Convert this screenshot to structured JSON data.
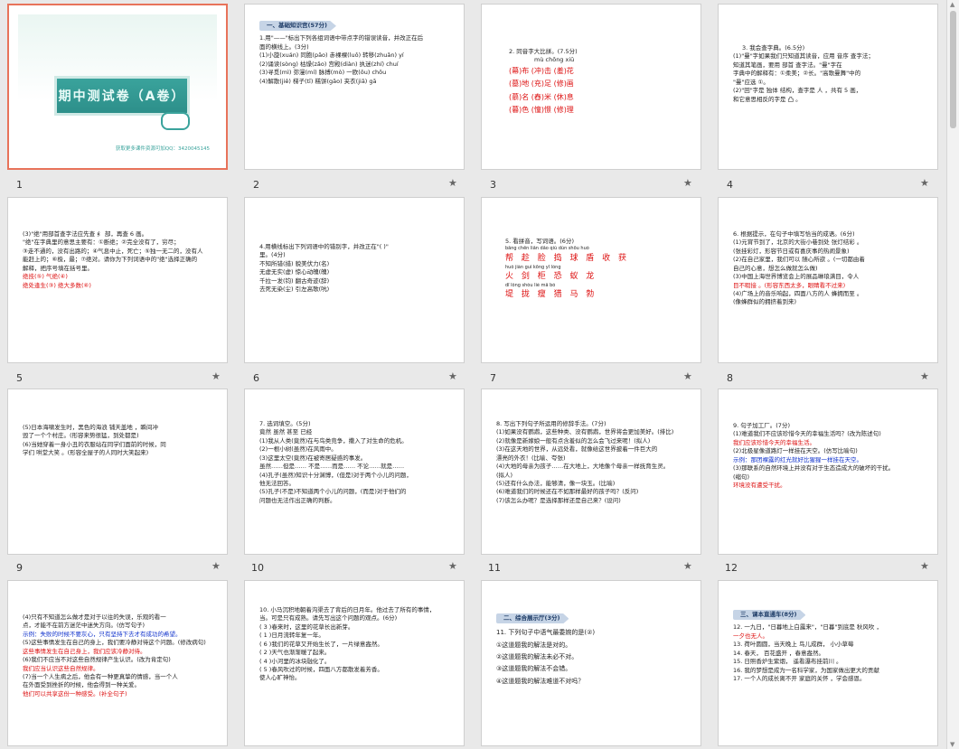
{
  "slides": [
    {
      "num": "1",
      "cover_title": "期中测试卷（A卷）",
      "footer": "获取更多课件资源可加QQ：3420045145"
    },
    {
      "num": "2",
      "section": "一、基础知识宫(57分)",
      "lines": [
        "1.用\"——\"标出下列各组词语中带点字的错误读音，并改正在后",
        "面的横线上。(3分)",
        "(1)小旋(xuán) 同胞(pāo) 赤裸裸(luǒ) 转移(zhuǎn) yí",
        "(2)诵读(sòng) 枯燥(zǎo) 宫殿(diàn) 执迷(zhí) chuí",
        "(3)寻觅(mì) 弥漫(mí) 脉搏(mò) 一欧(ōu) chōu",
        "(4)解散(jiě) 梯子(tī) 糕饼(gāo) 夹衣(jiā) gā"
      ]
    },
    {
      "num": "3",
      "lines": [
        "2. 同音字大比拼。(7.5分)",
        "mù       chōng       xiū",
        "(幕)布 (冲)击 (羞)花",
        "(墓)地 (充)足 (修)画",
        "(慕)名 (舂)米 (休)息",
        "(暮)色 (憧)憬 (修)理"
      ]
    },
    {
      "num": "4",
      "lines": [
        "3. 我会查字典。(6.5分)",
        "(1)\"曼\"字如果我们只知道其读音，应用 音序 查字法；",
        "知道其笔画，要用 部首 查字法。\"曼\"字在",
        "字典中的解释有：①柔美；②长。\"高歌曼舞\"中的",
        "\"曼\"应选 ①。",
        "(2)\"回\"字是 独体 结构，查字是 人 ，共有 5 画，",
        "和它意思相反的字是 凸 。"
      ]
    },
    {
      "num": "5",
      "lines": [
        "(3)\"绝\"用部首查字法应先查 纟 部，再查 6 画。",
        "\"绝\"在字典里的意思主要有：①断绝；②完全没有了，穷尽；",
        "③走不通的，没有出路的；④气息中止，死亡；⑤独一无二的，没有人",
        "能赶上的；⑥极，最；⑦绝对。请你为下列词语中的\"绝\"选择正确的",
        "解释，把序号填在括号里。",
        "绝技(⑤)          气绝(④)",
        "绝处逢生(③)      绝大多数(⑥)"
      ]
    },
    {
      "num": "6",
      "lines": [
        "4.用横线标出下列词语中的错别字，并改正在\"(   )\"",
        "里。(4分)",
        "不知所错(措)     貌美伏力(名)",
        "无虚无实(虚)     惊心动魄(魄)",
        "千拉一发(钧)     翻古奇迹(辞)",
        "去死无染(尘)     引左高歌(吭)"
      ]
    },
    {
      "num": "7",
      "lines": [
        "5. 看拼音，写词语。(6分)",
        "bāng  chēn  liǎn  dǎo  qiú  dùn  shōu  huò",
        "帮 趁 脸 捣 球 盾 收 获",
        "huǒ  jiàn  guì  kōng  yǐ  lóng",
        "火 剑 柜 恐 蚁 龙",
        "dī  lǒng  shòu  liè  mǎ  bó",
        "堤 拢 瘦 猎 马 勃"
      ]
    },
    {
      "num": "8",
      "lines": [
        "6. 根据提示，在句子中填写恰当的成语。(6分)",
        "(1)元宵节到了，北京的大街小巷到处 张灯结彩 。",
        "(张挂彩灯，形容节日或有喜庆事的热闹景象)",
        "(2)在自己家里，我们可以 随心所欲 。(一切都由着",
        "自己的心意，想怎么做就怎么做)",
        "(3)中国上海世界博览会上的展品琳琅满目，令人",
        "目不暇接 。(形容东西太多，眼睛看不过来)",
        "(4)广场上的音乐响起，四面八方的人 蜂拥而至 。",
        "(像蜂群似的拥挤着到来)"
      ]
    },
    {
      "num": "9",
      "lines": [
        "(5)日本海啸发生时，黑色的海浪 铺天盖地 ，瞬间冲",
        "毁了一个个村庄。(形容来势很猛，到处都是)",
        "(6)当她穿着一身小丑的衣服站在同学们面前的时候，同",
        "学们 哄堂大笑 。(形容全屋子的人同时大笑起来)"
      ]
    },
    {
      "num": "10",
      "lines": [
        "7. 选词填空。(5分)",
        "          竟然   虽然   甚至   已经",
        "(1)我从人类(竟然)在与鸟类竞争，撒入了对生命的危机。",
        "(2)一根小树(虽然)在风雨中。",
        "(3)这里太空(竟然)在被寄居疑惑的事发。",
        "虽然……但是……   不是……而是……   不论……就是……",
        "(4)孔子(虽然)知识十分渊博，(但是)对于两个小儿的问题，",
        "他无法回答。",
        "(5)孔子(不是)不知道两个小儿的问题，(而是)对于他们的",
        "问题也无法作出正确的判断。"
      ]
    },
    {
      "num": "11",
      "lines": [
        "8. 写出下列句子所运用的修辞手法。(7分)",
        "(1)如果没有鹦鹉，这些种类、没有鹦鹉，世界将会更加美好。(排比)",
        "(2)就像是新嫁娘一般有点含羞似的怎么会飞过来呢！(拟人)",
        "(3)在这天地的世界，从远处看，就像给这世界披着一件巨大的",
        "漂亮的外衣！(比喻、夸张)",
        "(4)大地的母亲为孩子……在大地上，大地像个母亲一样抚育生灵。",
        "(拟人)",
        "(5)还有什么办法，能够清，像一块玉。(比喻)",
        "(6)难道我们的时候还在不如那样最好的孩子吗？(反问)",
        "(7)该怎么办呢？是选择那样还是自己来？(设问)"
      ]
    },
    {
      "num": "12",
      "lines": [
        "9. 句子加工厂。(7分)",
        "(1)难道我们不应该珍惜今天的幸福生活吗？(改为陈述句)",
        "我们应该珍惜今天的幸福生活。",
        "(2)北极星像道路灯一样挂在天空。(仿写比喻句)",
        "示例：那团裸露的红光就好比猩猩一样挂在天空。",
        "(3)那联系的自然环境上并没有对于生态造成大的破坏的干扰。",
        "(缩句)",
        "环境没有遭受干扰。"
      ]
    },
    {
      "num": "13",
      "lines": [
        "(4)只有不知道怎么做才是对于以往的失误，乐观的看一",
        "点，才能不在前方迷茫中迷失方向。(仿写句子)",
        "示例：失败的时候不要灰心，只有坚持下去才有成功的希望。",
        "(5)这些事情发生在自己的身上，我们要冷静对待这个问题。(修改病句)",
        "这些事情发生在自己身上，我们应该冷静对待。",
        "(6)我们不应当不对这些自然规律产生认识。(改为肯定句)",
        "我们应当认识这些自然规律。",
        "(7)当一个人生病之后，他会有一种更真挚的情感，当一个人",
        "在外面受到挫折的时候，他会得到一种关爱。",
        "他们可以共享这份一种感受。(补全句子)"
      ]
    },
    {
      "num": "14",
      "lines": [
        "10. 小马沉积地朝着沟渠去了背后的日月年。他过去了所有的事情，",
        "当。可是只有成熟。请先写出这个问题的观点。(6分)",
        "( 3 )春来时，这里的花草长出新芽。",
        "( 1 )日月流转年复一年。",
        "( 6 )我们的花草又开始生长了，一片绿意盎然。",
        "( 2 )天气也渐渐暖了起来。",
        "( 4 )小河里的冰块融化了。",
        "( 5 )春风吹过的时候，四面八方都散发着芳香。",
        "使人心旷神怡。"
      ]
    },
    {
      "num": "15",
      "section": "二、综合展示厅(3分)",
      "lines": [
        "11. 下列句子中语气最委婉的是(②)",
        "①这道题我的解法是对的。",
        "②这道题我的解法未必不对。",
        "③这道题我的解法不会错。",
        "④这道题我的解法难道不对吗？"
      ]
    },
    {
      "num": "16",
      "section": "三、课本直通车(8分)",
      "lines": [
        "12. 一九日，\"日暮地上白露来\"，\"日暮\"到底是 秋风吹 ，",
        "一夕也无人。",
        "13. 荷叶圆圆，当天晚上 鸟儿成群， 小小草莓",
        "14. 春天， 百花盛开 ，春意盎然。",
        "15. 日照香炉生紫烟， 遥看瀑布挂前川 。",
        "16. 我的梦想是成为一名科学家，为国家做出更大的贡献",
        "17. 一个人的成长离不开 家庭的关怀 ，学会感恩。"
      ]
    }
  ]
}
